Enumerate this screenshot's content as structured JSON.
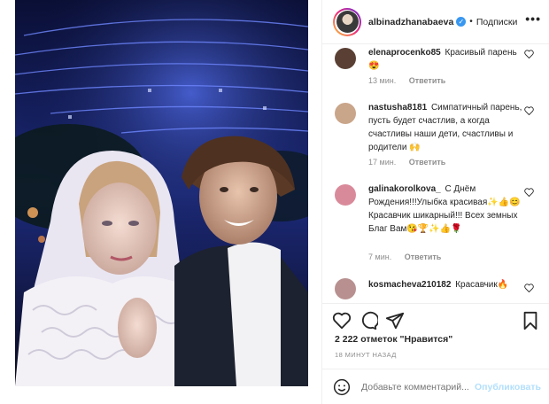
{
  "header": {
    "username": "albinadzhanabaeva",
    "separator": "•",
    "follow_status": "Подписки",
    "more": "•••"
  },
  "comments": [
    {
      "user": "elenaprocenko85",
      "text": "Красивый парень 😍",
      "time": "13 мин.",
      "reply": "Ответить",
      "avatar_color": "#5a4034"
    },
    {
      "user": "nastusha8181",
      "text": "Симпатичный парень, пусть будет счастлив, а когда счастливы наши дети, счастливы и родители 🙌",
      "time": "17 мин.",
      "reply": "Ответить",
      "avatar_color": "#c9a58a"
    },
    {
      "user": "galinakorolkova_",
      "text": "С Днём Рождения!!!Улыбка красивая✨👍😊Красавчик шикарный!!! Всех земных Благ Вам😘🏆✨👍🌹",
      "time": "7 мин.",
      "reply": "Ответить",
      "avatar_color": "#d98a9a"
    },
    {
      "user": "kosmacheva210182",
      "text": "Красавчик🔥",
      "avatar_color": "#b89090"
    }
  ],
  "likes_text": "2 222 отметок \"Нравится\"",
  "time_ago": "18 МИНУТ НАЗАД",
  "add_comment": {
    "placeholder": "Добавьте комментарий...",
    "publish": "Опубликовать"
  },
  "icons": {
    "verified": "verified-badge-icon",
    "like": "heart-icon",
    "comment": "comment-icon",
    "share": "share-icon",
    "save": "bookmark-icon",
    "emoji": "smiley-icon"
  },
  "colors": {
    "accent": "#3897f0",
    "muted": "#8e8e8e",
    "publish_disabled": "#b2dffc"
  }
}
